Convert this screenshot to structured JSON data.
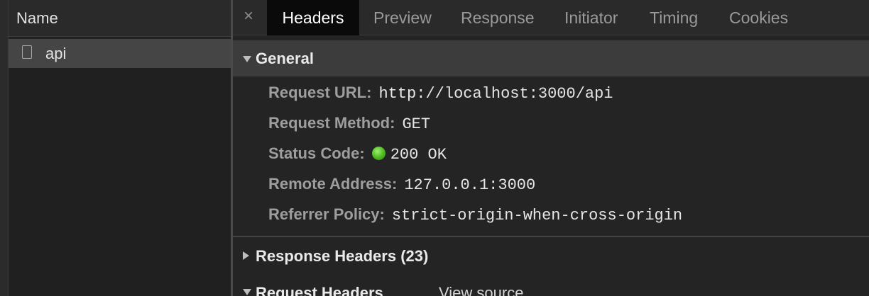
{
  "request_list": {
    "header": "Name",
    "items": [
      {
        "name": "api"
      }
    ]
  },
  "tabs": {
    "close": "×",
    "items": [
      {
        "label": "Headers",
        "active": true
      },
      {
        "label": "Preview"
      },
      {
        "label": "Response"
      },
      {
        "label": "Initiator"
      },
      {
        "label": "Timing"
      },
      {
        "label": "Cookies"
      }
    ]
  },
  "general": {
    "title": "General",
    "expanded": true,
    "rows": [
      {
        "key": "Request URL:",
        "value": "http://localhost:3000/api"
      },
      {
        "key": "Request Method:",
        "value": "GET"
      },
      {
        "key": "Status Code:",
        "value": "200 OK",
        "status_color": "#4cb81e"
      },
      {
        "key": "Remote Address:",
        "value": "127.0.0.1:3000"
      },
      {
        "key": "Referrer Policy:",
        "value": "strict-origin-when-cross-origin"
      }
    ]
  },
  "response_headers": {
    "title": "Response Headers (23)",
    "expanded": false
  },
  "request_headers": {
    "title": "Request Headers",
    "expanded": true,
    "view_source": "View source"
  },
  "colors": {
    "background": "#242424",
    "active_tab_bg": "#0a0a0a",
    "selected_row_bg": "#454545",
    "section_header_bg": "#3c3c3c",
    "status_ok": "#4cb81e"
  }
}
